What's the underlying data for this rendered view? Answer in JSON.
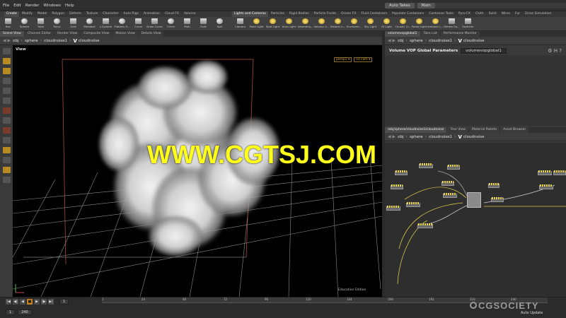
{
  "menubar": {
    "items": [
      "File",
      "Edit",
      "Render",
      "Windows",
      "Help"
    ],
    "autotakes": "Auto Takes",
    "take": "Main"
  },
  "shelf_tabs_left": [
    "Create",
    "Modify",
    "Model",
    "Polygon",
    "Deform",
    "Texture",
    "Character",
    "Auto Rigs",
    "Animation",
    "Cloud FX",
    "Volume"
  ],
  "shelf_tabs_right": [
    "Lights and Cameras",
    "Particles",
    "Rigid Bodies",
    "Particle Fluids",
    "Ocean FX",
    "Fluid Containers",
    "Populate Containers",
    "Container Tools",
    "Pyro FX",
    "Cloth",
    "Solid",
    "Wires",
    "Fur",
    "Drive Simulation"
  ],
  "tools_left": [
    "Box",
    "Sphere",
    "Tube",
    "Torus",
    "Grid",
    "Metaball",
    "L-System",
    "Platonic S...",
    "Curve",
    "Draw Curve",
    "Circle",
    "Path",
    "Font",
    "Null",
    "Rivet"
  ],
  "tools_right": [
    "Camera",
    "Point Light",
    "Spot Light",
    "Area Light",
    "Geometry...",
    "Volume Li...",
    "Distant Li...",
    "Environm...",
    "Sky Light",
    "GI Light",
    "Caustic Li...",
    "Portal Light",
    "Ambient L...",
    "Stereo Ca...",
    "Switcher"
  ],
  "viewport_tabs": [
    "Scene View",
    "Channel Editor",
    "Render View",
    "Composite View",
    "Motion View",
    "Details View"
  ],
  "path_left": [
    "obj",
    "sphere",
    "cloudnoise1",
    "cloudnoise"
  ],
  "viewport": {
    "label": "View",
    "persp": "persp1 ▾",
    "cam": "no cam ▾",
    "edition": "Education Edition"
  },
  "right_top_tabs": [
    "volumevopglobal1",
    "Take List",
    "Performance Monitor"
  ],
  "path_right": [
    "obj",
    "sphere",
    "cloudnoise1",
    "cloudnoise"
  ],
  "params": {
    "title": "Volume VOP Global Parameters",
    "name": "volumevopglobal1"
  },
  "net_tabs": [
    "/obj/sphere/cloudnoise1/cloudnoise",
    "Tree View",
    "Material Palette",
    "Asset Browser"
  ],
  "path_net": [
    "obj",
    "sphere",
    "cloudnoise1",
    "cloudnoise"
  ],
  "watermark": "WWW.CGTSJ.COM",
  "timeline": {
    "frame": "1",
    "start": "1",
    "end": "240",
    "ticks": [
      "1",
      "24",
      "48",
      "72",
      "96",
      "120",
      "144",
      "168",
      "192",
      "216",
      "240"
    ]
  },
  "brand": "CGSOCIETY",
  "auto_update": "Auto Update"
}
